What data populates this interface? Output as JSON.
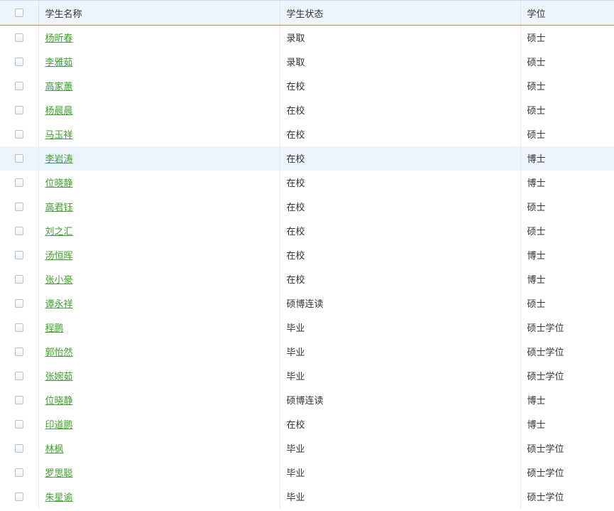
{
  "table": {
    "headers": {
      "name": "学生名称",
      "status": "学生状态",
      "degree": "学位"
    },
    "rows": [
      {
        "name": "杨昕春",
        "status": "录取",
        "degree": "硕士"
      },
      {
        "name": "李雅茹",
        "status": "录取",
        "degree": "硕士"
      },
      {
        "name": "高家蕙",
        "status": "在校",
        "degree": "硕士"
      },
      {
        "name": "杨晨晨",
        "status": "在校",
        "degree": "硕士"
      },
      {
        "name": "马玉祥",
        "status": "在校",
        "degree": "硕士"
      },
      {
        "name": "李岩涛",
        "status": "在校",
        "degree": "博士",
        "highlighted": true
      },
      {
        "name": "位晓静",
        "status": "在校",
        "degree": "博士"
      },
      {
        "name": "高君钰",
        "status": "在校",
        "degree": "硕士"
      },
      {
        "name": "刘之汇",
        "status": "在校",
        "degree": "硕士"
      },
      {
        "name": "汤恒晖",
        "status": "在校",
        "degree": "博士"
      },
      {
        "name": "张小豪",
        "status": "在校",
        "degree": "博士"
      },
      {
        "name": "谭永祥",
        "status": "硕博连读",
        "degree": "硕士"
      },
      {
        "name": "程鹏",
        "status": "毕业",
        "degree": "硕士学位"
      },
      {
        "name": "郭怡然",
        "status": "毕业",
        "degree": "硕士学位"
      },
      {
        "name": "张婉茹",
        "status": "毕业",
        "degree": "硕士学位"
      },
      {
        "name": "位晓静",
        "status": "硕博连读",
        "degree": "博士"
      },
      {
        "name": "印道鹏",
        "status": "在校",
        "degree": "博士"
      },
      {
        "name": "林枫",
        "status": "毕业",
        "degree": "硕士学位"
      },
      {
        "name": "罗思聪",
        "status": "毕业",
        "degree": "硕士学位"
      },
      {
        "name": "朱星谕",
        "status": "毕业",
        "degree": "硕士学位"
      }
    ]
  },
  "colors": {
    "link": "#3fa22b",
    "header_bg": "#eef4fb",
    "header_border": "#5aa0dc",
    "row_highlight": "#ecf3fb"
  }
}
